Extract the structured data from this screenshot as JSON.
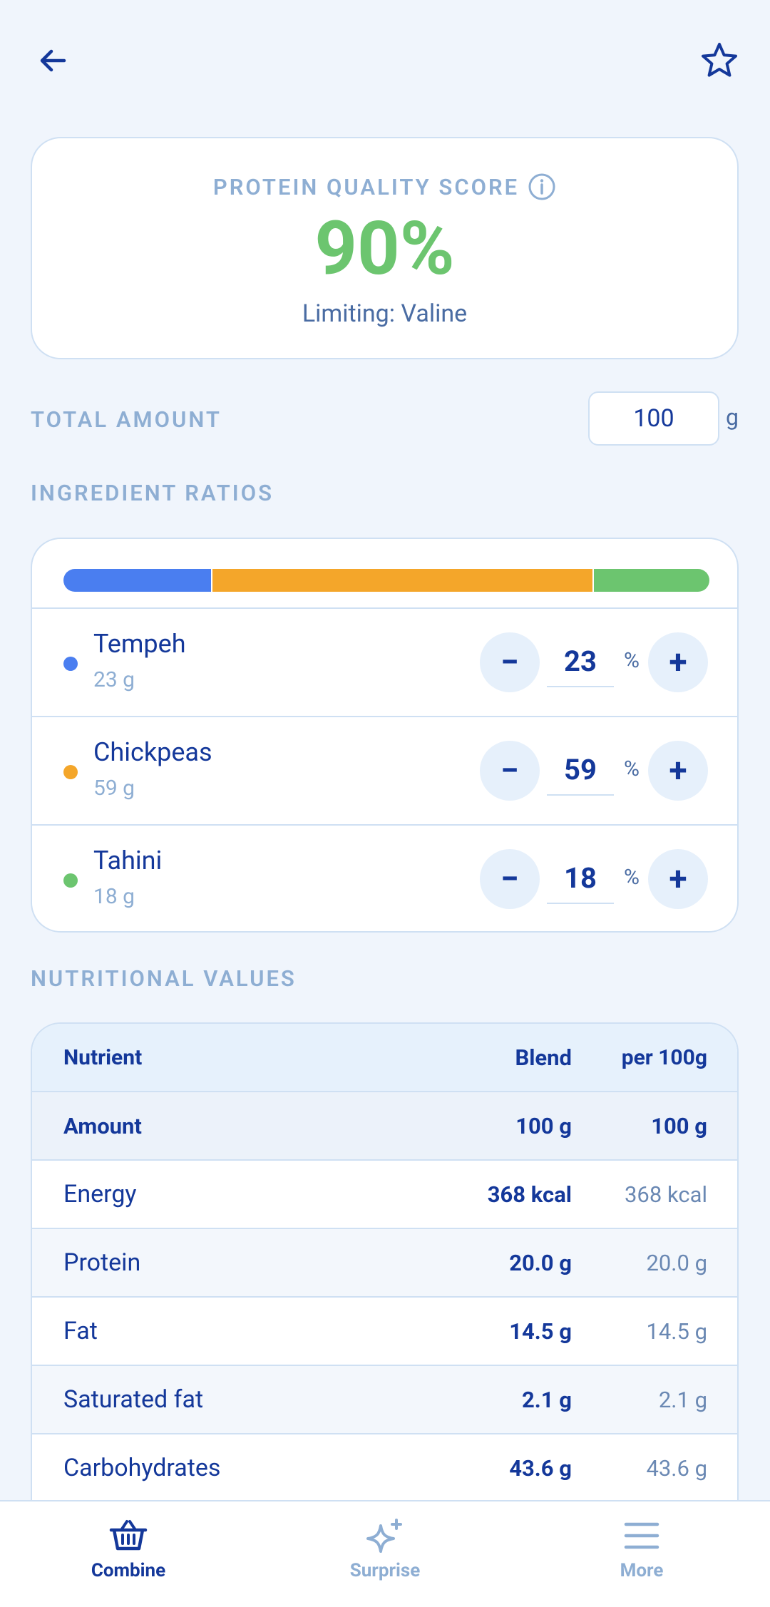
{
  "header": {
    "back_icon": "arrow-left-icon",
    "favorite_icon": "star-outline-icon"
  },
  "score": {
    "title": "PROTEIN QUALITY SCORE",
    "value": "90%",
    "limiting": "Limiting: Valine",
    "value_color": "#6cc56f"
  },
  "total_amount": {
    "label": "TOTAL AMOUNT",
    "value": "100",
    "unit": "g"
  },
  "ratios": {
    "label": "INGREDIENT RATIOS",
    "items": [
      {
        "name": "Tempeh",
        "grams": "23 g",
        "percent": "23",
        "pct_sign": "%",
        "color": "#4a7ef0",
        "share": 23,
        "minus": "−",
        "plus": "+"
      },
      {
        "name": "Chickpeas",
        "grams": "59 g",
        "percent": "59",
        "pct_sign": "%",
        "color": "#f4a62a",
        "share": 59,
        "minus": "−",
        "plus": "+"
      },
      {
        "name": "Tahini",
        "grams": "18 g",
        "percent": "18",
        "pct_sign": "%",
        "color": "#6cc56f",
        "share": 18,
        "minus": "−",
        "plus": "+"
      }
    ]
  },
  "nutrition": {
    "label": "NUTRITIONAL VALUES",
    "columns": [
      "Nutrient",
      "Blend",
      "per 100g"
    ],
    "rows": [
      {
        "name": "Amount",
        "blend": "100 g",
        "per100": "100 g"
      },
      {
        "name": "Energy",
        "blend": "368 kcal",
        "per100": "368 kcal"
      },
      {
        "name": "Protein",
        "blend": "20.0 g",
        "per100": "20.0 g"
      },
      {
        "name": "Fat",
        "blend": "14.5 g",
        "per100": "14.5 g"
      },
      {
        "name": "Saturated fat",
        "blend": "2.1 g",
        "per100": "2.1 g"
      },
      {
        "name": "Carbohydrates",
        "blend": "43.6 g",
        "per100": "43.6 g"
      }
    ]
  },
  "nav": {
    "items": [
      {
        "label": "Combine",
        "icon": "basket-icon",
        "active": true
      },
      {
        "label": "Surprise",
        "icon": "sparkle-icon",
        "active": false
      },
      {
        "label": "More",
        "icon": "menu-icon",
        "active": false
      }
    ],
    "active_color": "#14389a",
    "inactive_color": "#8eaed3"
  }
}
